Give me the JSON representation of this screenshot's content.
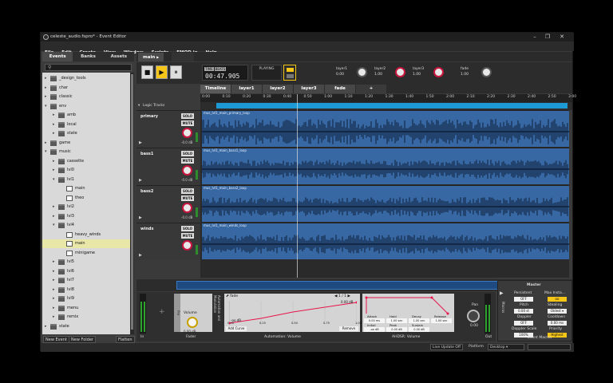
{
  "window": {
    "title": "celeste_audio.fspro* - Event Editor",
    "controls": [
      "–",
      "❐",
      "✕"
    ]
  },
  "menu": [
    "File",
    "Edit",
    "Create",
    "View",
    "Window",
    "Scripts",
    "FMOD.io",
    "Help"
  ],
  "browser": {
    "tabs": [
      "Events",
      "Banks",
      "Assets"
    ],
    "search_icon": "search-icon",
    "tree": [
      {
        "label": "_design_tools",
        "type": "folder",
        "depth": 1,
        "expanded": false
      },
      {
        "label": "char",
        "type": "folder",
        "depth": 1,
        "expanded": false
      },
      {
        "label": "classic",
        "type": "folder",
        "depth": 1,
        "expanded": false
      },
      {
        "label": "env",
        "type": "folder",
        "depth": 1,
        "expanded": true
      },
      {
        "label": "amb",
        "type": "folder",
        "depth": 2,
        "expanded": false
      },
      {
        "label": "local",
        "type": "folder",
        "depth": 2,
        "expanded": false
      },
      {
        "label": "state",
        "type": "folder",
        "depth": 2,
        "expanded": false
      },
      {
        "label": "game",
        "type": "folder",
        "depth": 1,
        "expanded": false
      },
      {
        "label": "music",
        "type": "folder",
        "depth": 1,
        "expanded": true
      },
      {
        "label": "cassette",
        "type": "folder",
        "depth": 2,
        "expanded": false
      },
      {
        "label": "lvl0",
        "type": "folder",
        "depth": 2,
        "expanded": false
      },
      {
        "label": "lvl1",
        "type": "folder",
        "depth": 2,
        "expanded": true
      },
      {
        "label": "main",
        "type": "event",
        "depth": 3
      },
      {
        "label": "theo",
        "type": "event",
        "depth": 3
      },
      {
        "label": "lvl2",
        "type": "folder",
        "depth": 2,
        "expanded": false
      },
      {
        "label": "lvl3",
        "type": "folder",
        "depth": 2,
        "expanded": false
      },
      {
        "label": "lvl4",
        "type": "folder",
        "depth": 2,
        "expanded": true
      },
      {
        "label": "heavy_winds",
        "type": "event",
        "depth": 3
      },
      {
        "label": "main",
        "type": "event",
        "depth": 3,
        "selected": true
      },
      {
        "label": "minigame",
        "type": "event",
        "depth": 3
      },
      {
        "label": "lvl5",
        "type": "folder",
        "depth": 2,
        "expanded": false
      },
      {
        "label": "lvl6",
        "type": "folder",
        "depth": 2,
        "expanded": false
      },
      {
        "label": "lvl7",
        "type": "folder",
        "depth": 2,
        "expanded": false
      },
      {
        "label": "lvl8",
        "type": "folder",
        "depth": 2,
        "expanded": false
      },
      {
        "label": "lvl9",
        "type": "folder",
        "depth": 2,
        "expanded": false
      },
      {
        "label": "menu",
        "type": "folder",
        "depth": 2,
        "expanded": false
      },
      {
        "label": "remix",
        "type": "folder",
        "depth": 2,
        "expanded": false
      },
      {
        "label": "state",
        "type": "folder",
        "depth": 1,
        "expanded": false
      }
    ],
    "buttons": {
      "new_event": "New Event",
      "new_folder": "New Folder",
      "flatten": "Flatten"
    }
  },
  "editor": {
    "tab": "main",
    "tab_marker": "▶",
    "transport": {
      "stop": "■",
      "play": "▶",
      "pause": "⏸",
      "mode_time": "TIME",
      "mode_beats": "BEATS",
      "time": "00:47.905",
      "status": "PLAYING"
    },
    "parameters": [
      {
        "name": "layer1",
        "value": "0.00",
        "knob": "white"
      },
      {
        "name": "layer2",
        "value": "1.00",
        "knob": "red"
      },
      {
        "name": "layer3",
        "value": "1.00",
        "knob": "red"
      },
      {
        "name": "fade",
        "value": "1.00",
        "knob": "white"
      }
    ],
    "timeline_tabs": [
      "Timeline",
      "layer1",
      "layer2",
      "layer3",
      "fade",
      "+"
    ],
    "ruler": [
      "0:00",
      "0:10",
      "0:20",
      "0:30",
      "0:40",
      "0:50",
      "1:00",
      "1:10",
      "1:20",
      "1:30",
      "1:40",
      "1:50",
      "2:00",
      "2:10",
      "2:20",
      "2:30",
      "2:40",
      "2:50",
      "3:00"
    ],
    "logic_tracks": "Logic Tracks",
    "tracks": [
      {
        "name": "primary",
        "clip": "mus_lvl1_main_primary_loop",
        "db": "-0.0 dB"
      },
      {
        "name": "bass1",
        "clip": "mus_lvl1_main_bass1_loop",
        "db": "-0.0 dB"
      },
      {
        "name": "bass2",
        "clip": "mus_lvl1_main_bass2_loop",
        "db": "-0.0 dB"
      },
      {
        "name": "winds",
        "clip": "mus_lvl1_main_winds_loop",
        "db": ""
      }
    ],
    "solo": "SOLO",
    "mute": "MUTE"
  },
  "deck": {
    "in_label": "In",
    "pre_label": "Pre",
    "volume_label": "Volume",
    "volume_value": "0.00 dB",
    "fader_label": "Fader",
    "automation_vertical": "Automation and Modulation",
    "automation": {
      "param": "fade",
      "page": "1 / 1",
      "top_db": "0.00 dB",
      "bottom_db": "-oo dB",
      "x_ticks": [
        "0.00",
        "0.25",
        "0.50",
        "0.75",
        "1.00"
      ],
      "add_curve": "Add Curve",
      "remove": "Remove",
      "title": "Automation: Volume"
    },
    "ahdsr": {
      "title": "AHDSR: Volume",
      "labels1": [
        "Attack",
        "Hold",
        "Decay",
        "Release"
      ],
      "values1": [
        "0.00 ms",
        "1.00 sec",
        "1.00 sec",
        "1.00 sec"
      ],
      "labels2": [
        "Initial",
        "Peak",
        "Sustain"
      ],
      "values2": [
        "-oo dB",
        "0.00 dB",
        "0.00 dB"
      ]
    },
    "pan_label": "Pan",
    "pan_value": "0.00",
    "out_label": "Out"
  },
  "macros": {
    "title": "Master",
    "vertical": "Macros",
    "persistent_label": "Persistent",
    "persistent": "OFF",
    "max_inst_label": "Max Insta...",
    "max_inst": "oo",
    "pitch_label": "Pitch",
    "pitch": "0.00 st",
    "stealing_label": "Stealing",
    "stealing": "Oldest ▾",
    "doppler_label": "Doppler",
    "doppler": "OFF",
    "cooldown_label": "Cooldown",
    "cooldown": "0.00 ms",
    "doppler_scale_label": "Doppler Scale",
    "doppler_scale": "100%",
    "priority_label": "Priority",
    "priority": "Highest",
    "footer": "Event Macros"
  },
  "footer": {
    "live_update": "Live Update Off",
    "platform_label": "Platform",
    "platform": "Desktop ▾"
  },
  "colors": {
    "accent_yellow": "#f5c518",
    "waveform_blue": "#3768a4",
    "logic_blue": "#1d9ad6",
    "curve_red": "#e8144a",
    "knob_red": "#c8163f"
  }
}
